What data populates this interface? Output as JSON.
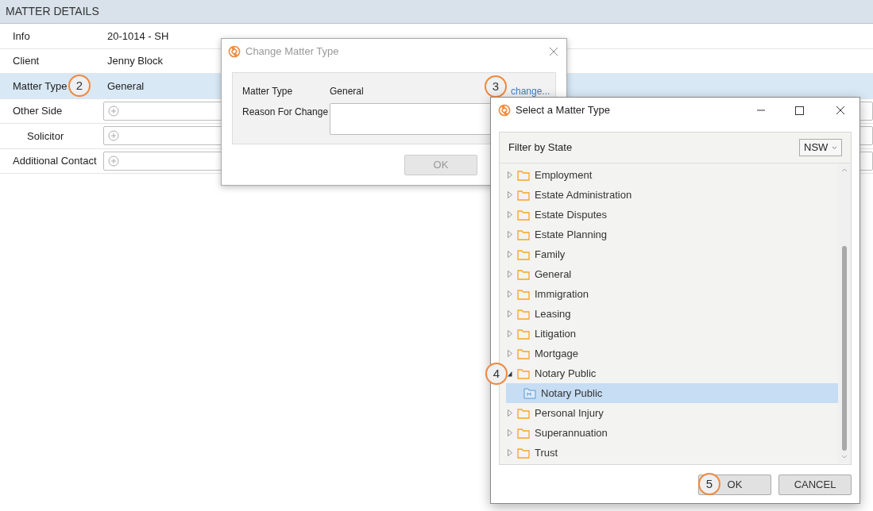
{
  "page": {
    "header": "MATTER DETAILS",
    "rows": [
      {
        "label": "Info",
        "kind": "text",
        "value": "20-1014 - SH",
        "selected": false
      },
      {
        "label": "Client",
        "kind": "text",
        "value": "Jenny Block",
        "selected": false
      },
      {
        "label": "Matter Type",
        "kind": "text",
        "value": "General",
        "selected": true,
        "badge": "2"
      },
      {
        "label": "Other Side",
        "kind": "field",
        "selected": false
      },
      {
        "label": "Solicitor",
        "kind": "field",
        "selected": false,
        "indented": true
      },
      {
        "label": "Additional Contact",
        "kind": "field",
        "selected": false
      }
    ]
  },
  "change_dialog": {
    "title": "Change Matter Type",
    "matter_type_label": "Matter Type",
    "matter_type_value": "General",
    "change_link": "change...",
    "change_badge": "3",
    "reason_label": "Reason For Change",
    "ok_button": "OK",
    "ok_disabled": true
  },
  "select_dialog": {
    "title": "Select a Matter Type",
    "filter_label": "Filter by State",
    "filter_value": "NSW",
    "tree": [
      {
        "label": "Employment",
        "expanded": false
      },
      {
        "label": "Estate Administration",
        "expanded": false
      },
      {
        "label": "Estate Disputes",
        "expanded": false
      },
      {
        "label": "Estate Planning",
        "expanded": false
      },
      {
        "label": "Family",
        "expanded": false
      },
      {
        "label": "General",
        "expanded": false
      },
      {
        "label": "Immigration",
        "expanded": false
      },
      {
        "label": "Leasing",
        "expanded": false
      },
      {
        "label": "Litigation",
        "expanded": false
      },
      {
        "label": "Mortgage",
        "expanded": false
      },
      {
        "label": "Notary Public",
        "expanded": true,
        "badge": "4",
        "children": [
          {
            "label": "Notary Public",
            "selected": true
          }
        ]
      },
      {
        "label": "Personal Injury",
        "expanded": false
      },
      {
        "label": "Superannuation",
        "expanded": false
      },
      {
        "label": "Trust",
        "expanded": false
      }
    ],
    "ok_button": "OK",
    "ok_badge": "5",
    "cancel_button": "CANCEL"
  }
}
